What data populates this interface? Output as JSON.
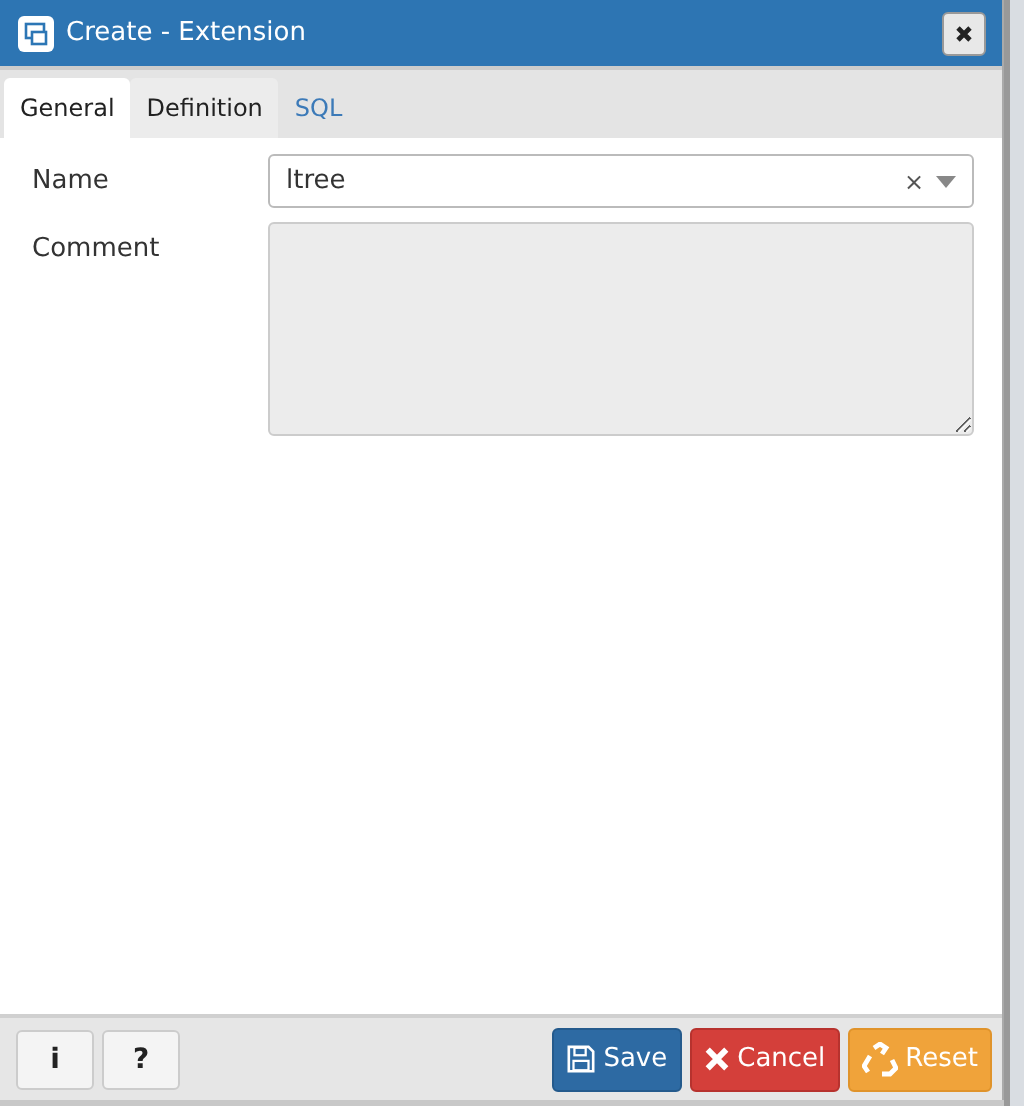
{
  "window": {
    "title": "Create - Extension"
  },
  "tabs": [
    {
      "label": "General",
      "selected": true
    },
    {
      "label": "Definition",
      "selected": false
    },
    {
      "label": "SQL",
      "selected": false
    }
  ],
  "fields": [
    {
      "kind": "select",
      "label": "Name",
      "value": "ltree",
      "clear": "×",
      "disabled": false
    },
    {
      "kind": "textarea",
      "label": "Comment",
      "disabled": true
    }
  ],
  "footer": {
    "left_buttons": [
      {
        "label": "i"
      },
      {
        "label": "?"
      }
    ],
    "buttons": [
      {
        "kind": "save",
        "label": "Save"
      },
      {
        "kind": "cancel",
        "label": "Cancel"
      },
      {
        "kind": "reset",
        "label": "Reset"
      }
    ]
  }
}
